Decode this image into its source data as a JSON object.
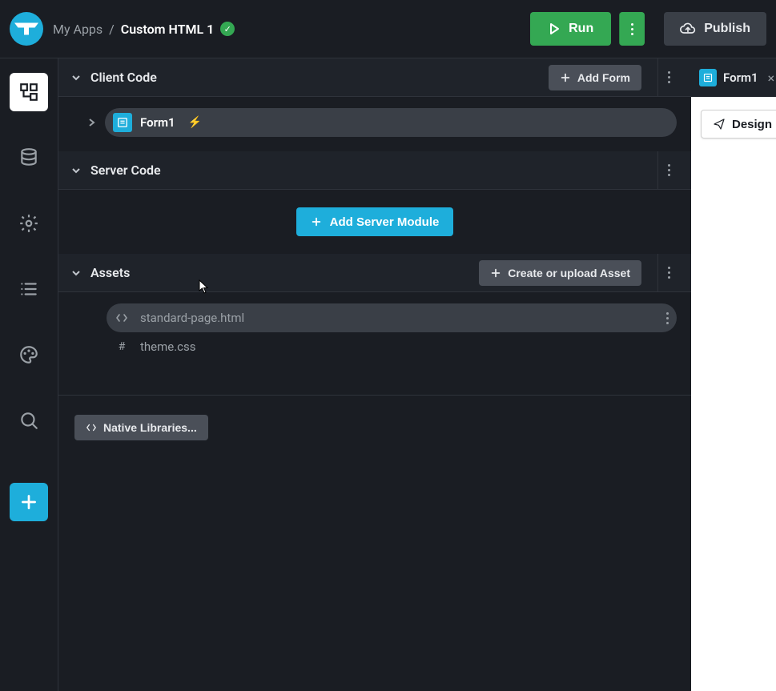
{
  "header": {
    "breadcrumb_parent": "My Apps",
    "breadcrumb_current": "Custom HTML 1",
    "run_label": "Run",
    "publish_label": "Publish"
  },
  "sections": {
    "client_code": {
      "title": "Client Code",
      "add_form_label": "Add Form",
      "items": [
        {
          "label": "Form1"
        }
      ]
    },
    "server_code": {
      "title": "Server Code",
      "add_module_label": "Add Server Module"
    },
    "assets": {
      "title": "Assets",
      "create_label": "Create or upload Asset",
      "items": [
        {
          "label": "standard-page.html",
          "icon": "code",
          "selected": true
        },
        {
          "label": "theme.css",
          "icon": "hash",
          "selected": false
        }
      ]
    },
    "native_libraries_label": "Native Libraries..."
  },
  "right_panel": {
    "tab_label": "Form1",
    "design_label": "Design"
  }
}
